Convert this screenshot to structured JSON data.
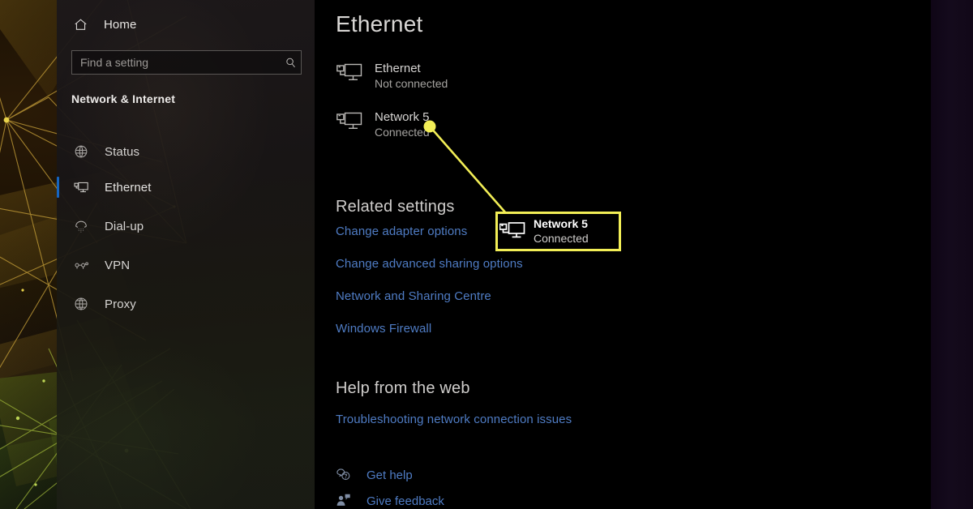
{
  "window": {
    "title": "Ethernet",
    "app": "Windows Settings"
  },
  "sidebar": {
    "home": {
      "label": "Home",
      "icon": "home-icon"
    },
    "search": {
      "value": "",
      "placeholder": "Find a setting",
      "icon": "search-icon"
    },
    "category": "Network & Internet",
    "items": [
      {
        "label": "Status",
        "icon": "status-globe-icon",
        "selected": false
      },
      {
        "label": "Ethernet",
        "icon": "ethernet-icon",
        "selected": true
      },
      {
        "label": "Dial-up",
        "icon": "dialup-phone-icon",
        "selected": false
      },
      {
        "label": "VPN",
        "icon": "vpn-nodes-icon",
        "selected": false
      },
      {
        "label": "Proxy",
        "icon": "globe-icon",
        "selected": false
      }
    ]
  },
  "main": {
    "heading": "Ethernet",
    "adapters": [
      {
        "name": "Ethernet",
        "status": "Not connected",
        "icon": "ethernet-adapter-icon"
      },
      {
        "name": "Network 5",
        "status": "Connected",
        "icon": "ethernet-adapter-icon"
      }
    ],
    "related_settings": {
      "heading": "Related settings",
      "links": [
        "Change adapter options",
        "Change advanced sharing options",
        "Network and Sharing Centre",
        "Windows Firewall"
      ]
    },
    "help_from_web": {
      "heading": "Help from the web",
      "links": [
        "Troubleshooting network connection issues"
      ]
    },
    "footer_links": [
      {
        "label": "Get help",
        "icon": "question-bubble-icon"
      },
      {
        "label": "Give feedback",
        "icon": "feedback-person-icon"
      }
    ]
  },
  "annotation": {
    "callout": {
      "name": "Network 5",
      "status": "Connected",
      "icon": "ethernet-adapter-icon",
      "border_color": "#f2ee56",
      "dot_color": "#f2ee56"
    }
  },
  "colors": {
    "accent_selection": "#1565c0",
    "link": "#4f7cc4",
    "annotation": "#f2ee56",
    "sidebar_bg": "#1c1819",
    "content_bg": "#000000"
  }
}
